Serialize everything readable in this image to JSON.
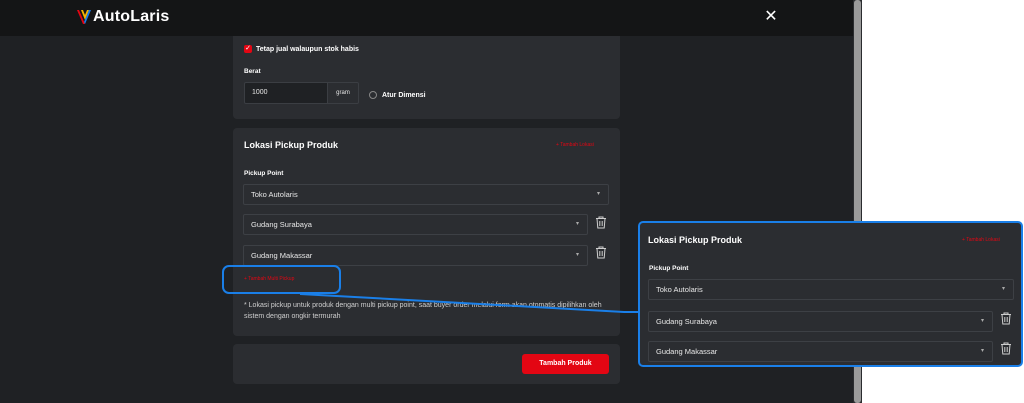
{
  "app": {
    "brand": "AutoLaris",
    "colors": {
      "accent": "#e30613",
      "highlight": "#1a7fe8",
      "background": "#1f2124",
      "card": "#2b2d31"
    }
  },
  "stock": {
    "keep_selling_label": "Tetap jual walaupun stok habis",
    "checked": true
  },
  "weight": {
    "label": "Berat",
    "value": "1000",
    "unit": "gram",
    "dimension_label": "Atur Dimensi"
  },
  "pickup": {
    "title": "Lokasi Pickup Produk",
    "add_location_label": "+ Tambah Lokasi",
    "pickup_point_label": "Pickup Point",
    "points": [
      "Toko Autolaris",
      "Gudang Surabaya",
      "Gudang Makassar"
    ],
    "add_multi_label": "+ Tambah Multi Pickup",
    "note": "* Lokasi pickup untuk produk dengan multi pickup point, saat buyer order melalui form akan otomatis dipilihkan oleh sistem dengan ongkir termurah"
  },
  "footer": {
    "submit_label": "Tambah Produk"
  },
  "icons": {
    "close": "close-icon",
    "trash": "trash-icon",
    "chevron": "chevron-down-icon",
    "check": "check-icon"
  }
}
